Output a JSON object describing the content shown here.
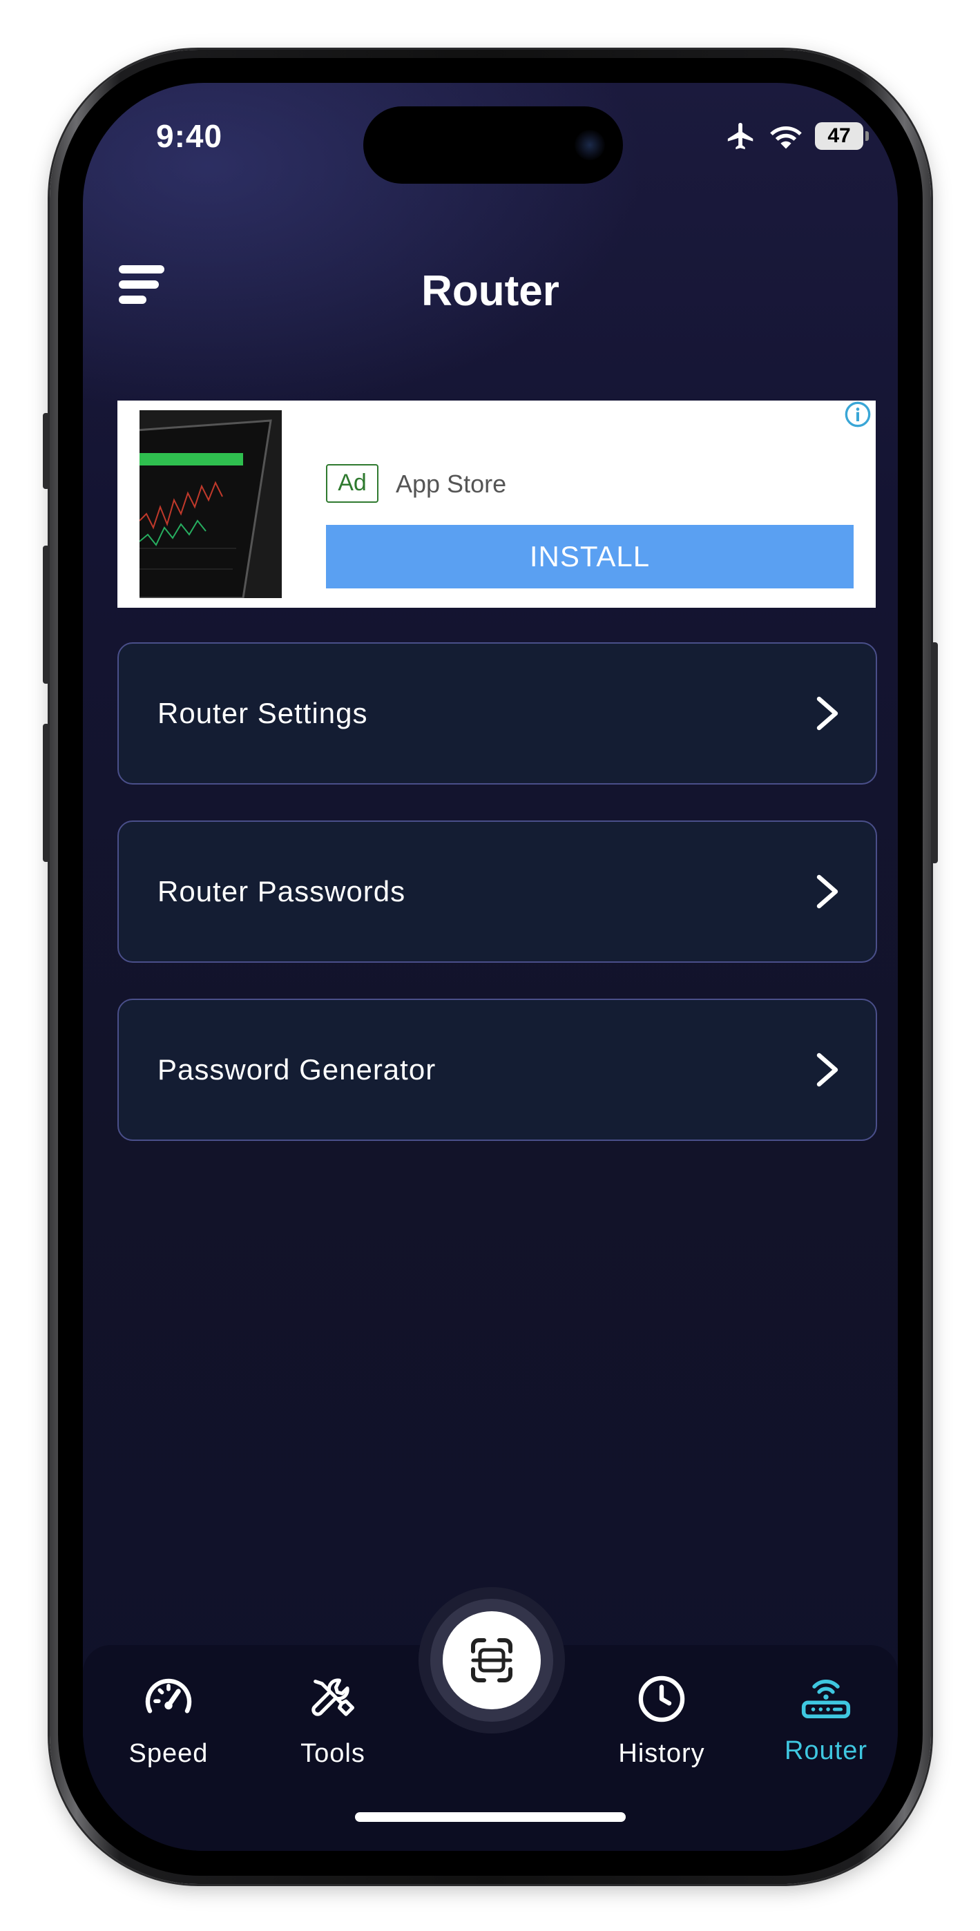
{
  "status_bar": {
    "time": "9:40",
    "battery": "47",
    "icons": [
      "airplane-icon",
      "wifi-icon",
      "battery-icon"
    ]
  },
  "header": {
    "title": "Router",
    "menu_icon": "menu-icon"
  },
  "ad": {
    "badge": "Ad",
    "source": "App Store",
    "install_label": "INSTALL",
    "info_icon": "info-icon"
  },
  "menu": {
    "items": [
      {
        "label": "Router Settings"
      },
      {
        "label": "Router Passwords"
      },
      {
        "label": "Password Generator"
      }
    ]
  },
  "tabbar": {
    "tabs": [
      {
        "label": "Speed",
        "icon": "speedometer-icon",
        "active": false
      },
      {
        "label": "Tools",
        "icon": "tools-icon",
        "active": false
      },
      {
        "label": "History",
        "icon": "clock-icon",
        "active": false
      },
      {
        "label": "Router",
        "icon": "router-icon",
        "active": true
      }
    ],
    "center_button_icon": "scan-icon"
  },
  "colors": {
    "accent": "#3fc7e0",
    "install_button": "#5aa0f2",
    "row_background": "#141d33",
    "row_border": "#4a4f8a"
  }
}
